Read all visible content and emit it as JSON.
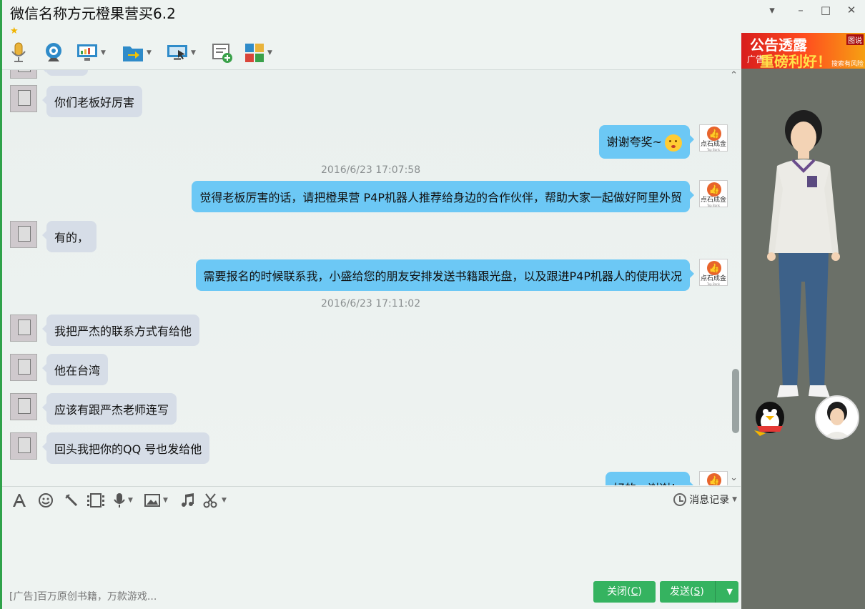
{
  "window": {
    "title": "微信名称方元橙果营买6.2",
    "controls": {
      "menu": "▾",
      "minimize": "–",
      "maximize": "□",
      "close": "✕"
    },
    "star_icon": "★"
  },
  "toolbar": {
    "items": [
      "microphone-icon",
      "webcam-icon",
      "screen-share-icon",
      "file-transfer-icon",
      "remote-desktop-icon",
      "add-chat-icon",
      "apps-icon"
    ]
  },
  "chat": {
    "messages": [
      {
        "side": "left",
        "text": "你们老板好厉害"
      },
      {
        "side": "right",
        "text": "谢谢夸奖~",
        "emoji": "kiss-emoji"
      },
      {
        "type": "timestamp",
        "text": "2016/6/23 17:07:58"
      },
      {
        "side": "right",
        "text": "觉得老板厉害的话，请把橙果营 P4P机器人推荐给身边的合作伙伴，帮助大家一起做好阿里外贸"
      },
      {
        "side": "left",
        "text": "有的，"
      },
      {
        "side": "right",
        "text": "需要报名的时候联系我，小盛给您的朋友安排发送书籍跟光盘，以及跟进P4P机器人的使用状况"
      },
      {
        "type": "timestamp",
        "text": "2016/6/23 17:11:02"
      },
      {
        "side": "left",
        "text": "我把严杰的联系方式有给他"
      },
      {
        "side": "left",
        "text": "他在台湾"
      },
      {
        "side": "left",
        "text": "应该有跟严杰老师连写"
      },
      {
        "side": "left",
        "text": "回头我把你的QQ 号也发给他"
      },
      {
        "side": "right",
        "text": "好的，谢谢！"
      }
    ],
    "right_avatar": {
      "brand": "点石成金",
      "sub": "Top Bank"
    }
  },
  "input": {
    "history_label": "消息记录",
    "ad_text": "[广告]百万原创书籍，万款游戏...",
    "close_button": "关闭(C)",
    "close_prefix": "关闭(",
    "close_key": "C",
    "send_prefix": "发送(",
    "send_key": "S",
    "close_suffix": ")",
    "send_suffix": ")"
  },
  "right_panel": {
    "banner_line1": "公告透露",
    "banner_line2": "重磅利好！",
    "banner_ad": "广告",
    "banner_corner": "图说",
    "banner_sub": "搜索有风险"
  },
  "colors": {
    "accent": "#35b360",
    "bubble_right": "#6cc8f5",
    "bubble_left": "#d6dde7",
    "side_panel": "#6b7068"
  }
}
